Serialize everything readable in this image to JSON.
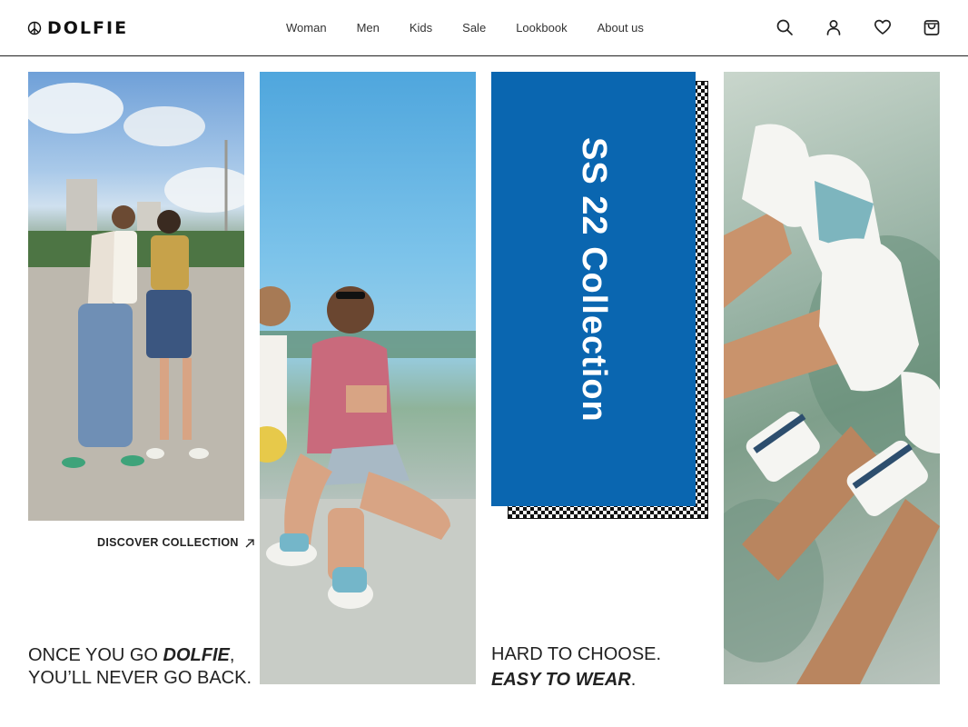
{
  "brand": {
    "name": "DOLFIE",
    "logo_icon": "peace-icon"
  },
  "nav": [
    "Woman",
    "Men",
    "Kids",
    "Sale",
    "Lookbook",
    "About us"
  ],
  "header_icons": [
    "search-icon",
    "user-icon",
    "heart-icon",
    "bag-icon"
  ],
  "collection": {
    "title": "SS 22 Collection",
    "accent": "#0a66b0"
  },
  "discover": {
    "label": "DISCOVER COLLECTION"
  },
  "tagline_left": {
    "line1_prefix": "ONCE YOU GO ",
    "line1_brand": "DOLFIE",
    "line1_suffix": ",",
    "line2": "YOU’LL NEVER GO BACK."
  },
  "tagline_right": {
    "line1": "HARD TO CHOOSE.",
    "line2_emph": "EASY TO WEAR",
    "line2_suffix": "."
  }
}
